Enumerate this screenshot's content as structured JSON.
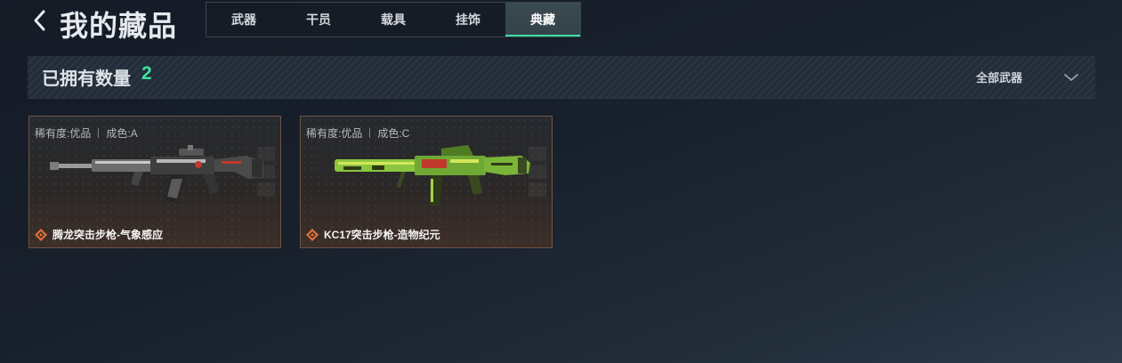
{
  "header": {
    "title": "我的藏品",
    "back_icon": "chevron-left-icon"
  },
  "tabs": [
    {
      "label": "武器",
      "active": false
    },
    {
      "label": "干员",
      "active": false
    },
    {
      "label": "载具",
      "active": false
    },
    {
      "label": "挂饰",
      "active": false
    },
    {
      "label": "典藏",
      "active": true
    }
  ],
  "summary": {
    "owned_label": "已拥有数量",
    "owned_count": "2",
    "filter_value": "全部武器",
    "filter_icon": "chevron-down-icon"
  },
  "items": [
    {
      "rarity": "稀有度:优品",
      "condition": "成色:A",
      "name": "腾龙突击步枪-气象感应",
      "icon": "diamond-rarity-icon"
    },
    {
      "rarity": "稀有度:优品",
      "condition": "成色:C",
      "name": "KC17突击步枪-造物纪元",
      "icon": "diamond-rarity-icon"
    }
  ],
  "colors": {
    "accent": "#3ee0a0",
    "card_border": "#6e5647",
    "rarity_icon": "#e0723a"
  }
}
